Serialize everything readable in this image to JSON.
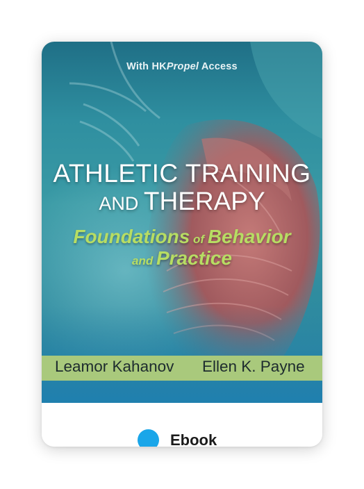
{
  "cover": {
    "kicker_prefix": "With HK",
    "kicker_italic": "Propel",
    "kicker_suffix": " Access",
    "title_line1": "ATHLETIC TRAINING",
    "title_line2_small": "AND ",
    "title_line2_main": "THERAPY",
    "subtitle_word1": "Foundations",
    "subtitle_of": " of ",
    "subtitle_word2": "Behavior",
    "subtitle_and": "and ",
    "subtitle_word3": "Practice",
    "author1": "Leamor Kahanov",
    "author2": "Ellen K. Payne"
  },
  "footer": {
    "format_icon": "circle-dot-icon",
    "format_label": "Ebook"
  },
  "colors": {
    "cover_teal": "#2f8fa0",
    "subtitle_green": "#b7dd63",
    "author_band": "#a9c97c",
    "ebook_dot": "#1aa6e9"
  }
}
